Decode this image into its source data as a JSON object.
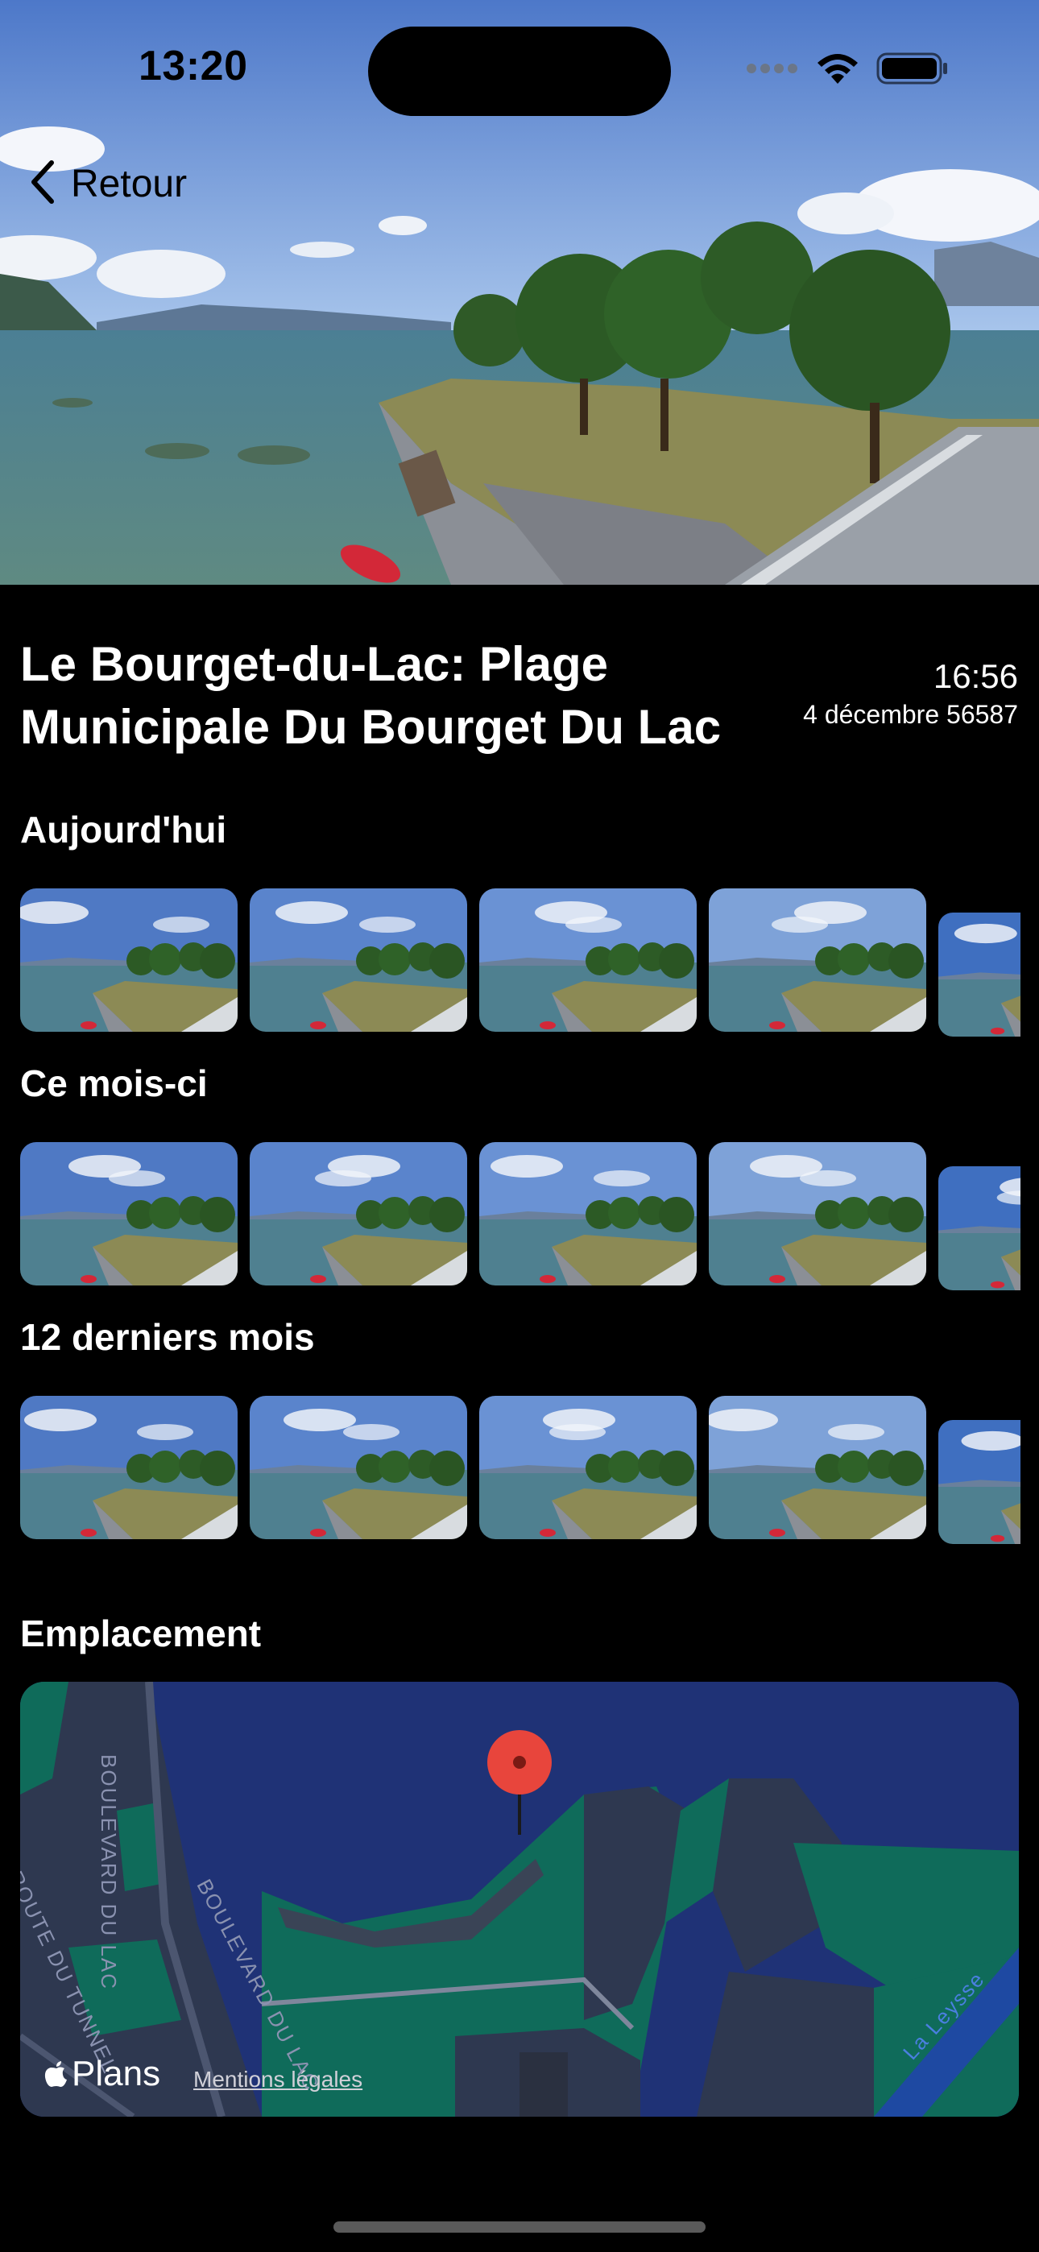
{
  "status_bar": {
    "time": "13:20"
  },
  "nav": {
    "back_label": "Retour"
  },
  "webcam": {
    "title": "Le Bourget-du-Lac: Plage Municipale Du Bourget Du Lac",
    "capture_time": "16:56",
    "capture_date": "4 décembre 56587"
  },
  "sections": {
    "today": {
      "title": "Aujourd'hui",
      "thumbnail_count": 5
    },
    "month": {
      "title": "Ce mois-ci",
      "thumbnail_count": 5
    },
    "year": {
      "title": "12 derniers mois",
      "thumbnail_count": 5
    }
  },
  "location": {
    "title": "Emplacement",
    "map_provider": "Plans",
    "legal_link": "Mentions légales",
    "street_labels": [
      "BOULEVARD DU LAC",
      "ROUTE DU TUNNEL",
      "BOULEVARD DU LAC",
      "La Leysse"
    ]
  },
  "colors": {
    "accent_pin": "#e8453c",
    "map_water": "#1f3276",
    "map_land": "#0f6b5a"
  }
}
